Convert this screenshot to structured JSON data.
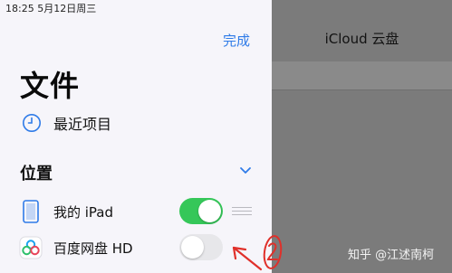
{
  "status_bar": {
    "time": "18:25   5月12日周三"
  },
  "sidebar": {
    "done_label": "完成",
    "title": "文件",
    "recent": {
      "label": "最近项目",
      "icon": "clock-icon"
    },
    "locations": {
      "title": "位置",
      "items": [
        {
          "label": "我的 iPad",
          "icon": "ipad-icon",
          "toggle_on": true
        },
        {
          "label": "百度网盘 HD",
          "icon": "baidu-netdisk-icon",
          "toggle_on": false
        }
      ]
    }
  },
  "detail": {
    "title": "iCloud 云盘"
  },
  "watermark": "知乎 @江述南柯",
  "colors": {
    "accent": "#2f7be8",
    "toggle_on": "#35c759",
    "annotation": "#e0302a"
  }
}
